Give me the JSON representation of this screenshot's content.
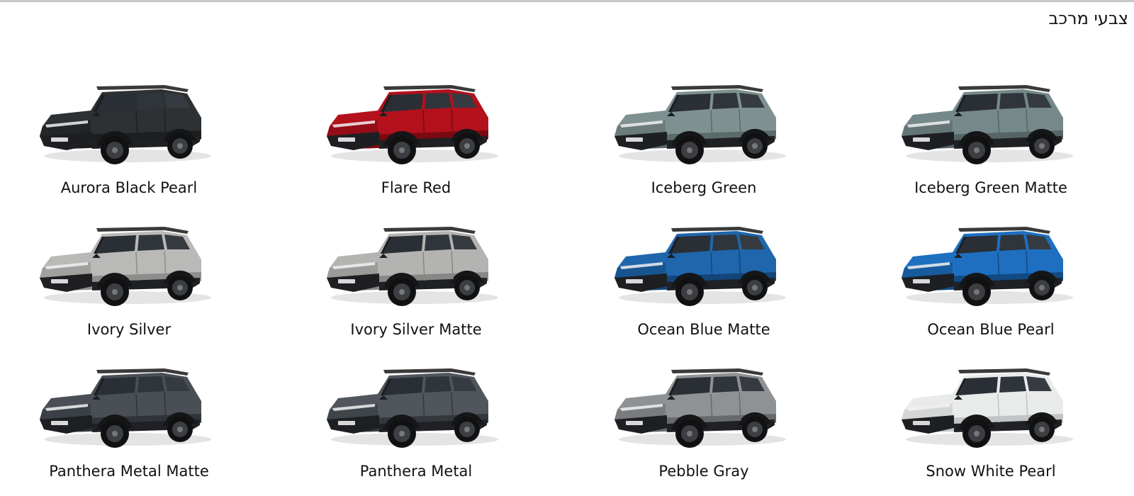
{
  "section": {
    "title": "צבעי מרכב"
  },
  "colors": [
    {
      "label": "Aurora Black Pearl",
      "paint": "#2e3133",
      "shade": "#1c1e20",
      "icon": "suv-car-image"
    },
    {
      "label": "Flare Red",
      "paint": "#b3111c",
      "shade": "#7a0a12",
      "icon": "suv-car-image"
    },
    {
      "label": "Iceberg Green",
      "paint": "#7e9190",
      "shade": "#5b6b6a",
      "icon": "suv-car-image"
    },
    {
      "label": "Iceberg Green Matte",
      "paint": "#76898a",
      "shade": "#566465",
      "icon": "suv-car-image"
    },
    {
      "label": "Ivory Silver",
      "paint": "#b9b9b7",
      "shade": "#8d8d8b",
      "icon": "suv-car-image"
    },
    {
      "label": "Ivory Silver Matte",
      "paint": "#b3b3b1",
      "shade": "#878785",
      "icon": "suv-car-image"
    },
    {
      "label": "Ocean Blue Matte",
      "paint": "#1f66ad",
      "shade": "#134578",
      "icon": "suv-car-image"
    },
    {
      "label": "Ocean Blue Pearl",
      "paint": "#1e6fc0",
      "shade": "#124a83",
      "icon": "suv-car-image"
    },
    {
      "label": "Panthera Metal Matte",
      "paint": "#4a4f55",
      "shade": "#30343a",
      "icon": "suv-car-image"
    },
    {
      "label": "Panthera Metal",
      "paint": "#50565c",
      "shade": "#33383d",
      "icon": "suv-car-image"
    },
    {
      "label": "Pebble Gray",
      "paint": "#8f9295",
      "shade": "#67696c",
      "icon": "suv-car-image"
    },
    {
      "label": "Snow White Pearl",
      "paint": "#e9eaea",
      "shade": "#c2c4c5",
      "icon": "suv-car-image"
    }
  ]
}
